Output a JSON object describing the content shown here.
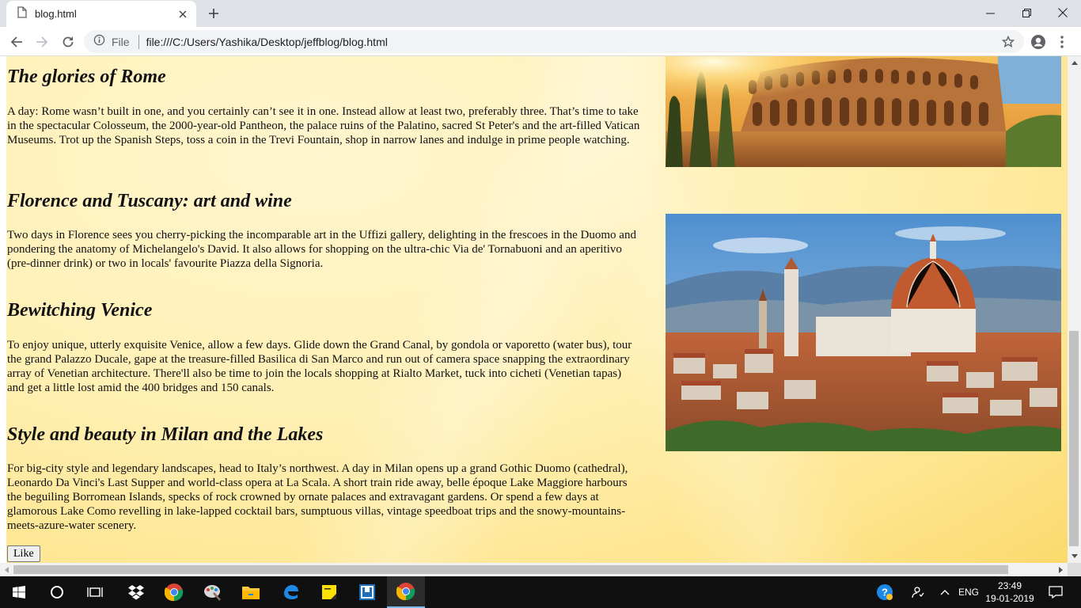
{
  "tab": {
    "title": "blog.html"
  },
  "omnibox": {
    "scheme_label": "File",
    "url": "file:///C:/Users/Yashika/Desktop/jeffblog/blog.html"
  },
  "article": {
    "sections": [
      {
        "heading": "The glories of Rome",
        "body": "A day: Rome wasn’t built in one, and you certainly can’t see it in one. Instead allow at least two, preferably three. That’s time to take in the spectacular Colosseum, the 2000-year-old Pantheon, the palace ruins of the Palatino, sacred St Peter's and the art-filled Vatican Museums. Trot up the Spanish Steps, toss a coin in the Trevi Fountain, shop in narrow lanes and indulge in prime people watching."
      },
      {
        "heading": "Florence and Tuscany: art and wine",
        "body": "Two days in Florence sees you cherry-picking the incomparable art in the Uffizi gallery, delighting in the frescoes in the Duomo and pondering the anatomy of Michelangelo's David. It also allows for shopping on the ultra-chic Via de' Tornabuoni and an aperitivo (pre-dinner drink) or two in locals' favourite Piazza della Signoria."
      },
      {
        "heading": "Bewitching Venice",
        "body": "To enjoy unique, utterly exquisite Venice, allow a few days. Glide down the Grand Canal, by gondola or vaporetto (water bus), tour the grand Palazzo Ducale, gape at the treasure-filled Basilica di San Marco and run out of camera space snapping the extraordinary array of Venetian architecture. There'll also be time to join the locals shopping at Rialto Market, tuck into cicheti (Venetian tapas) and get a little lost amid the 400 bridges and 150 canals."
      },
      {
        "heading": "Style and beauty in Milan and the Lakes",
        "body": "For big-city style and legendary landscapes, head to Italy’s northwest. A day in Milan opens up a grand Gothic Duomo (cathedral), Leonardo Da Vinci's Last Supper and world-class opera at La Scala. A short train ride away, belle époque Lake Maggiore harbours the beguiling Borromean Islands, specks of rock crowned by ornate palaces and extravagant gardens. Or spend a few days at glamorous Lake Como revelling in lake-lapped cocktail bars, sumptuous villas, vintage speedboat trips and the snowy-mountains-meets-azure-water scenery."
      }
    ],
    "like_label": "Like"
  },
  "taskbar": {
    "language": "ENG",
    "time": "23:49",
    "date": "19-01-2019"
  },
  "colors": {
    "page_background": "#fff0b4",
    "taskbar": "#101010",
    "tab_strip": "#dee1e6"
  }
}
